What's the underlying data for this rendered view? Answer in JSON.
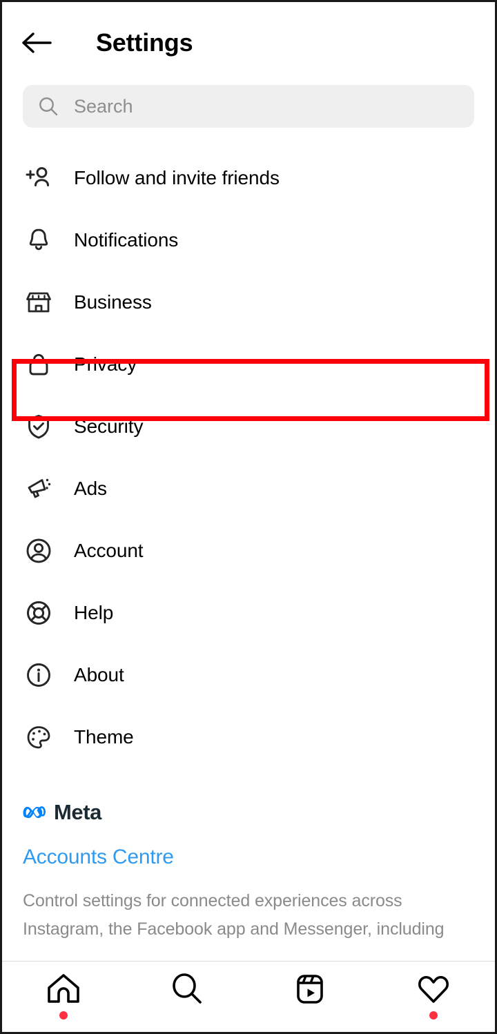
{
  "header": {
    "title": "Settings",
    "back_icon": "back-arrow-icon"
  },
  "search": {
    "placeholder": "Search",
    "value": "",
    "icon": "search-icon"
  },
  "menu": {
    "items": [
      {
        "label": "Follow and invite friends",
        "icon": "add-person-icon",
        "highlighted": false
      },
      {
        "label": "Notifications",
        "icon": "bell-icon",
        "highlighted": false
      },
      {
        "label": "Business",
        "icon": "storefront-icon",
        "highlighted": false
      },
      {
        "label": "Privacy",
        "icon": "lock-icon",
        "highlighted": true
      },
      {
        "label": "Security",
        "icon": "shield-check-icon",
        "highlighted": false
      },
      {
        "label": "Ads",
        "icon": "megaphone-icon",
        "highlighted": false
      },
      {
        "label": "Account",
        "icon": "user-circle-icon",
        "highlighted": false
      },
      {
        "label": "Help",
        "icon": "life-ring-icon",
        "highlighted": false
      },
      {
        "label": "About",
        "icon": "info-circle-icon",
        "highlighted": false
      },
      {
        "label": "Theme",
        "icon": "palette-icon",
        "highlighted": false
      }
    ]
  },
  "meta": {
    "brand": "Meta",
    "logo_icon": "meta-infinity-icon",
    "link_label": "Accounts Centre",
    "description": "Control settings for connected experiences across Instagram, the Facebook app and Messenger, including"
  },
  "bottom_nav": {
    "items": [
      {
        "name": "home",
        "icon": "home-icon",
        "badge": true
      },
      {
        "name": "search",
        "icon": "search-icon",
        "badge": false
      },
      {
        "name": "reels",
        "icon": "reels-icon",
        "badge": false
      },
      {
        "name": "activity",
        "icon": "heart-icon",
        "badge": true
      }
    ]
  },
  "colors": {
    "highlight": "#FB0007",
    "link": "#2E9BF0",
    "meta_blue": "#0082FB",
    "badge": "#FF3040",
    "search_bg": "#EFEFEF",
    "placeholder": "#8E8E8E",
    "muted_text": "#8A8A8A"
  }
}
